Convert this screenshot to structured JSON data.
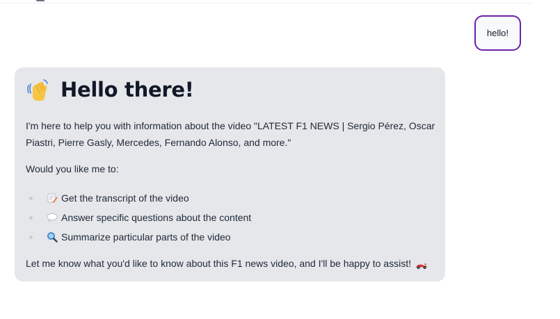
{
  "user_message": {
    "text": "hello!"
  },
  "assistant_message": {
    "greeting_icon": "waving-hand-icon",
    "greeting": "Hello there!",
    "intro": "I'm here to help you with information about the video \"LATEST F1 NEWS | Sergio Pérez, Oscar Piastri, Pierre Gasly, Mercedes, Fernando Alonso, and more.\"",
    "prompt": "Would you like me to:",
    "options": [
      {
        "icon": "memo-icon",
        "label": "Get the transcript of the video"
      },
      {
        "icon": "speech-bubble-icon",
        "label": "Answer specific questions about the content"
      },
      {
        "icon": "magnifying-glass-icon",
        "label": "Summarize particular parts of the video"
      }
    ],
    "closing": "Let me know what you'd like to know about this F1 news video, and I'll be happy to assist!",
    "closing_icon": "race-car-icon"
  },
  "colors": {
    "user_bubble_border": "#6b21a8",
    "user_bubble_bg": "#f8f9fb",
    "assistant_bubble_bg": "#e5e7eb",
    "text": "#1f2937"
  }
}
